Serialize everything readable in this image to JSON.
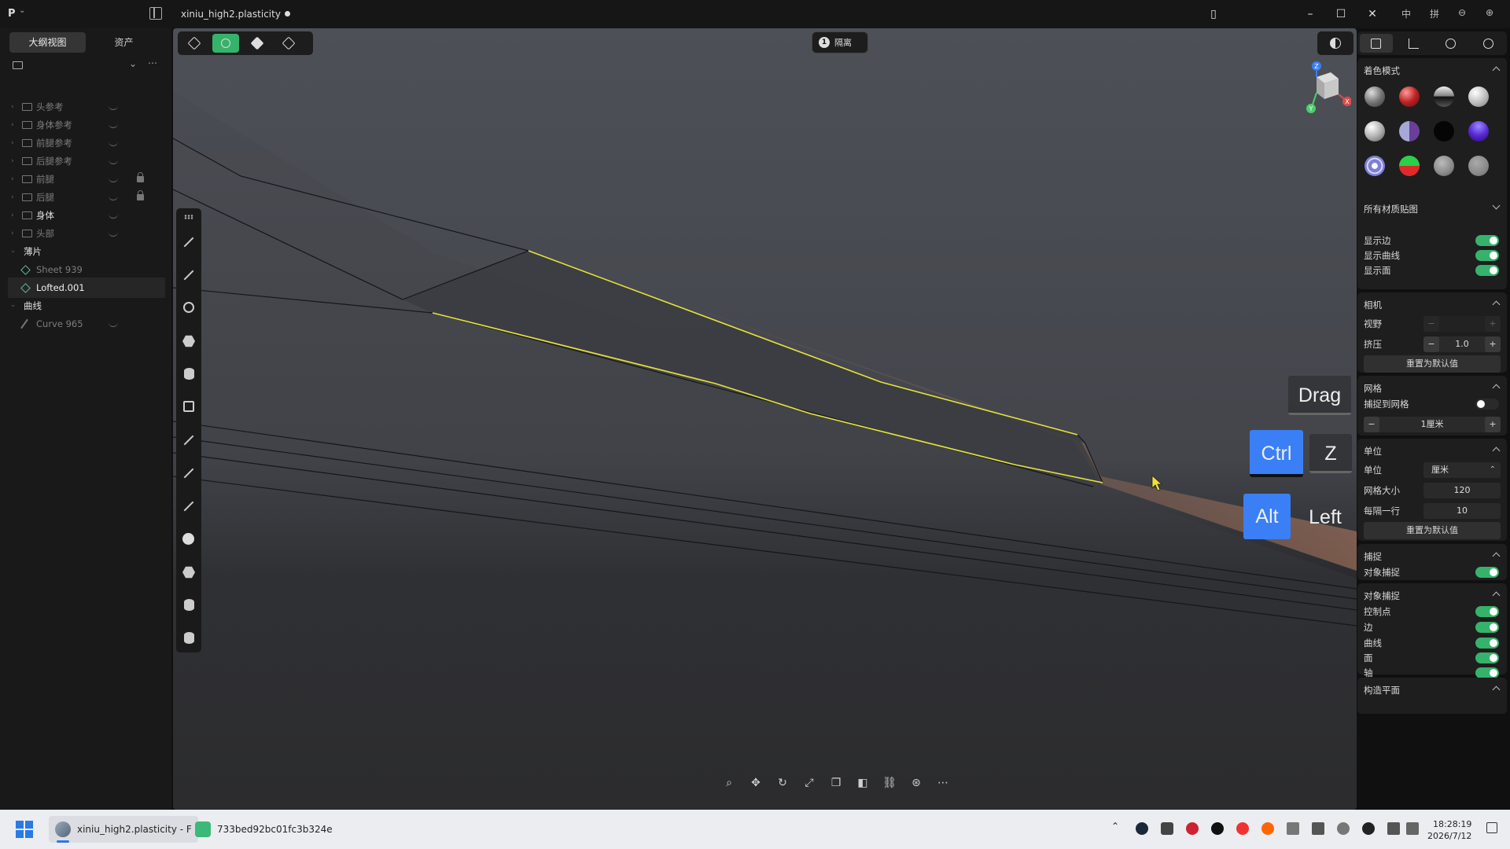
{
  "titlebar": {
    "app_logo": "P",
    "document_title": "xiniu_high2.plasticity",
    "lang_label": "中",
    "mode_label": "拼"
  },
  "outliner": {
    "tabs": [
      "大纲视图",
      "资产"
    ],
    "active_tab": 0,
    "items": [
      {
        "label": "头参考",
        "type": "folder",
        "locked": false,
        "bright": false
      },
      {
        "label": "身体参考",
        "type": "folder",
        "locked": false,
        "bright": false
      },
      {
        "label": "前腿参考",
        "type": "folder",
        "locked": false,
        "bright": false
      },
      {
        "label": "后腿参考",
        "type": "folder",
        "locked": false,
        "bright": false
      },
      {
        "label": "前腿",
        "type": "folder",
        "locked": true,
        "bright": false
      },
      {
        "label": "后腿",
        "type": "folder",
        "locked": true,
        "bright": false
      },
      {
        "label": "身体",
        "type": "folder",
        "locked": false,
        "bright": true
      },
      {
        "label": "头部",
        "type": "folder",
        "locked": false,
        "bright": false
      },
      {
        "label": "薄片",
        "type": "group",
        "locked": false,
        "bright": true
      },
      {
        "label": "Sheet 939",
        "type": "shape",
        "locked": false,
        "bright": false
      },
      {
        "label": "Lofted.001",
        "type": "shape",
        "locked": false,
        "bright": true,
        "selected": true
      },
      {
        "label": "曲线",
        "type": "group",
        "locked": false,
        "bright": true
      },
      {
        "label": "Curve 965",
        "type": "curve",
        "locked": false,
        "bright": false
      }
    ]
  },
  "viewport": {
    "isolate_count": "1",
    "isolate_label": "隔离",
    "keys": {
      "drag": "Drag",
      "ctrl": "Ctrl",
      "z": "Z",
      "alt": "Alt",
      "left": "Left"
    },
    "axes": {
      "z": "Z",
      "x": "X",
      "y": "Y"
    }
  },
  "right_panel": {
    "shading": {
      "title": "着色模式",
      "materials_label": "所有材质贴图",
      "show_edges": "显示边",
      "show_curves": "显示曲线",
      "show_faces": "显示面"
    },
    "camera": {
      "title": "相机",
      "fov_label": "视野",
      "squash_label": "挤压",
      "squash_value": "1.0",
      "reset": "重置为默认值"
    },
    "grid": {
      "title": "网格",
      "snap_to_grid": "捕捉到网格",
      "grid_step": "1厘米"
    },
    "units": {
      "title": "单位",
      "unit_label": "单位",
      "unit_value": "厘米",
      "grid_size_label": "网格大小",
      "grid_size_value": "120",
      "every_row_label": "每隔一行",
      "every_row_value": "10",
      "reset": "重置为默认值"
    },
    "snap": {
      "title": "捕捉",
      "object_snap": "对象捕捉"
    },
    "object_snap": {
      "title": "对象捕捉",
      "items": [
        "控制点",
        "边",
        "曲线",
        "面",
        "轴"
      ]
    },
    "construction_plane": {
      "title": "构造平面"
    }
  },
  "taskbar": {
    "apps": [
      {
        "label": "xiniu_high2.plasticity - F"
      },
      {
        "label": "733bed92bc01fc3b324e"
      }
    ],
    "time": "18:28:19",
    "date": "2026/7/12"
  },
  "colors": {
    "accent_green": "#36b26b",
    "key_blue": "#3a7ff5",
    "selection_yellow": "#e6e23a"
  }
}
